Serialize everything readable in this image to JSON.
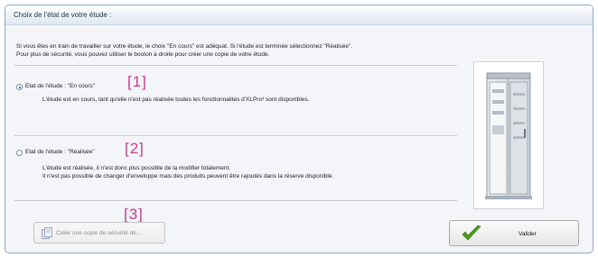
{
  "dialog": {
    "title": "Choix de l'état de votre étude :",
    "intro_line1": "Si vous êtes en train de travailler sur votre étude, le choix \"En cours\" est adéquat. Si l'étude est terminée sélectionnez \"Réalisée\".",
    "intro_line2": "Pour plus de sécurité, vous pouvez utiliser le bouton à droite pour créer une copie de votre étude."
  },
  "options": [
    {
      "label": "Etat de l'étude : \"En cours\"",
      "selected": true,
      "marker": "[1]",
      "description": [
        "L'étude est en cours, tant qu'elle n'est pas réalisée toutes les fonctionnalités d'XLPro³ sont disponibles."
      ]
    },
    {
      "label": "Etat de l'étude : \"Réalisée\"",
      "selected": false,
      "marker": "[2]",
      "description": [
        "L'étude est réalisée, il n'est donc plus possible de la modifier totalement.",
        "Il n'est pas possible de changer d'enveloppe mais des produits peuvent être rajoutés dans la réserve disponible."
      ]
    }
  ],
  "backup_button": {
    "label": "Créer une copie de sécurité de...",
    "marker": "[3]",
    "icon": "backup-icon",
    "enabled": false
  },
  "validate_button": {
    "label": "Valider",
    "icon": "checkmark-icon"
  },
  "colors": {
    "marker": "#c63d93",
    "check_green": "#4e9a1e",
    "selected_radio": "#1d4f9e"
  },
  "cabinet_image": {
    "icon": "electrical-cabinet-icon"
  }
}
